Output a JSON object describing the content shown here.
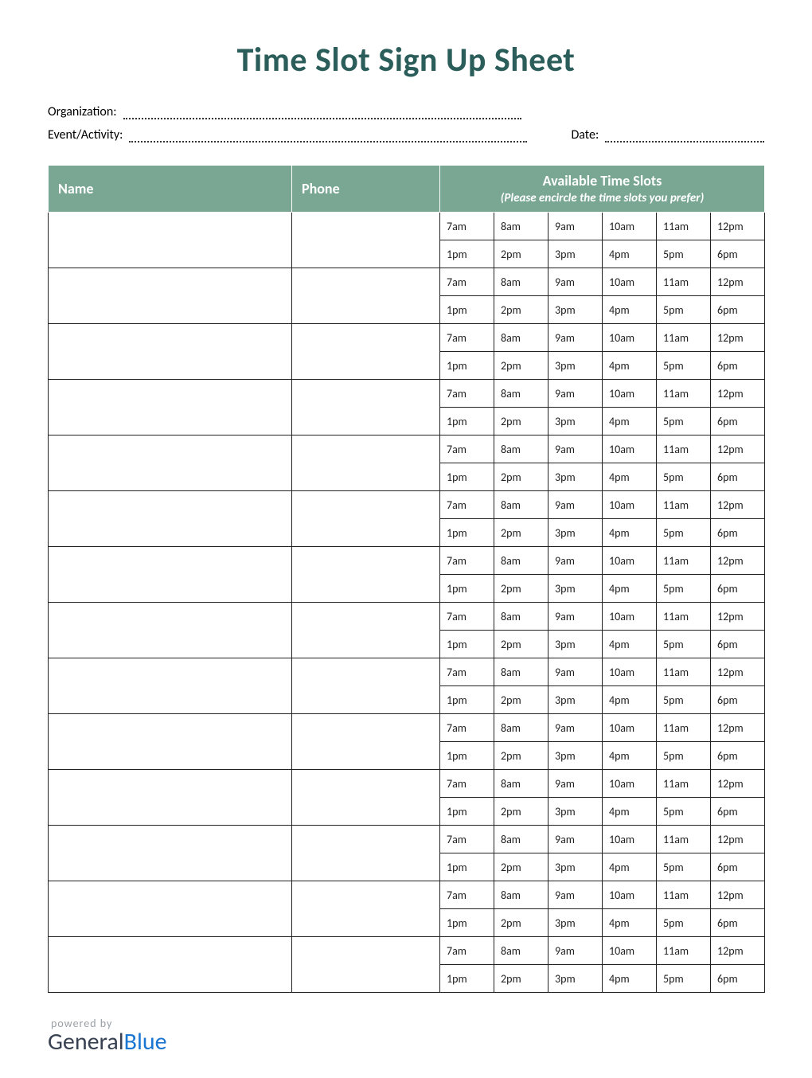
{
  "title": "Time Slot Sign Up Sheet",
  "meta": {
    "organization_label": "Organization:",
    "event_label": "Event/Activity:",
    "date_label": "Date:"
  },
  "headers": {
    "name": "Name",
    "phone": "Phone",
    "slots_title": "Available Time Slots",
    "slots_sub": "(Please encircle the time slots you prefer)"
  },
  "time_slots_am": [
    "7am",
    "8am",
    "9am",
    "10am",
    "11am",
    "12pm"
  ],
  "time_slots_pm": [
    "1pm",
    "2pm",
    "3pm",
    "4pm",
    "5pm",
    "6pm"
  ],
  "row_count": 14,
  "footer": {
    "powered_by": "powered by",
    "brand_1": "General",
    "brand_2": "Blue"
  }
}
